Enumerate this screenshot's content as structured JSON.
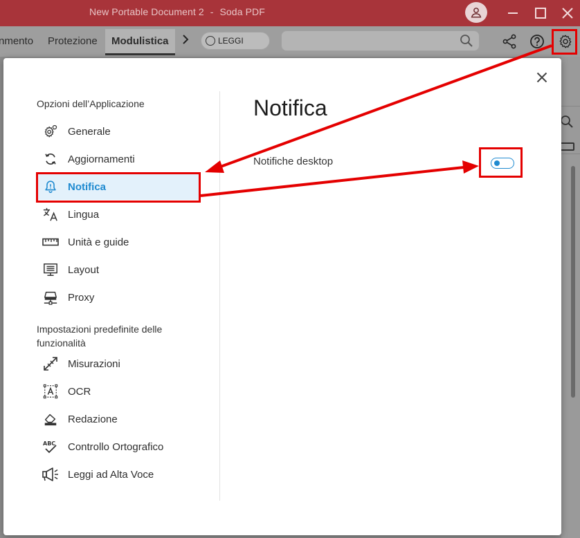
{
  "window": {
    "document_title": "New Portable Document 2",
    "separator": "-",
    "app_name": "Soda PDF"
  },
  "toolbar": {
    "tabs": [
      {
        "label": "nmento"
      },
      {
        "label": "Protezione"
      },
      {
        "label": "Modulistica",
        "active": true
      }
    ],
    "read_mode_label": "LEGGI",
    "search": {
      "placeholder": "",
      "value": ""
    }
  },
  "dialog": {
    "sections": [
      {
        "title": "Opzioni dell’Applicazione",
        "items": [
          {
            "label": "Generale",
            "icon": "gear-icon"
          },
          {
            "label": "Aggiornamenti",
            "icon": "refresh-icon"
          },
          {
            "label": "Notifica",
            "icon": "bell-icon",
            "selected": true
          },
          {
            "label": "Lingua",
            "icon": "translate-icon"
          },
          {
            "label": "Unità e guide",
            "icon": "ruler-icon"
          },
          {
            "label": "Layout",
            "icon": "layout-icon"
          },
          {
            "label": "Proxy",
            "icon": "network-icon"
          }
        ]
      },
      {
        "title": "Impostazioni predefinite delle funzionalità",
        "items": [
          {
            "label": "Misurazioni",
            "icon": "measure-icon"
          },
          {
            "label": "OCR",
            "icon": "ocr-icon"
          },
          {
            "label": "Redazione",
            "icon": "eraser-icon"
          },
          {
            "label": "Controllo Ortografico",
            "icon": "spellcheck-icon"
          },
          {
            "label": "Leggi ad Alta Voce",
            "icon": "megaphone-icon"
          }
        ]
      }
    ],
    "panel": {
      "title": "Notifica",
      "settings": [
        {
          "label": "Notifiche desktop",
          "enabled": true
        }
      ]
    }
  },
  "colors": {
    "titlebar": "#a8343a",
    "accent": "#1f8ad0",
    "highlight_annotation": "#e40000",
    "selected_bg": "#e3f1fb"
  }
}
